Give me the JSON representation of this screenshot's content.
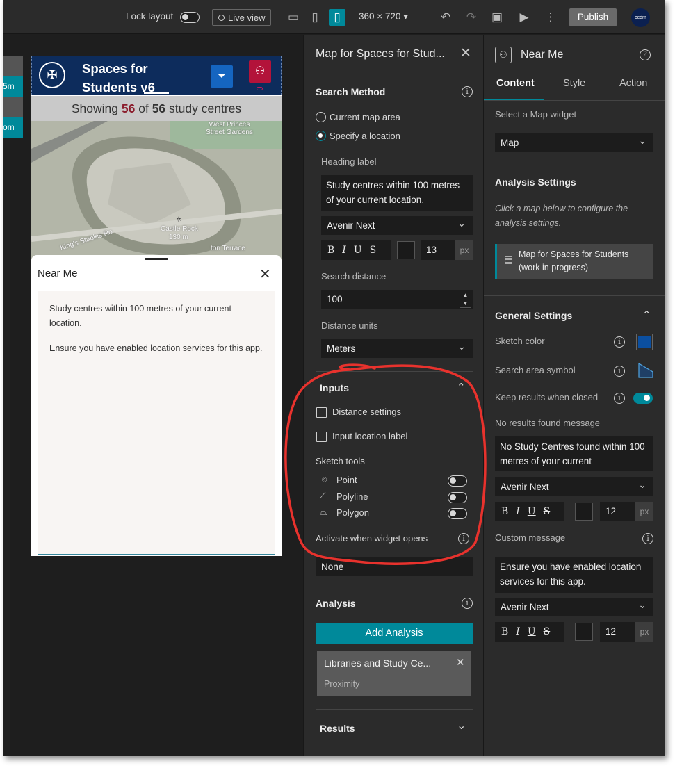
{
  "toolbar": {
    "lock_layout": "Lock layout",
    "lock_layout_on": false,
    "live_view": "Live view",
    "resolution": "360 × 720",
    "publish": "Publish",
    "avatar_text": "ccdm"
  },
  "canvas": {
    "side_labels": [
      "5m",
      "om"
    ],
    "app": {
      "title": "Spaces for Students v6",
      "showing_prefix": "Showing",
      "showing_count": "56",
      "showing_of": "of",
      "showing_total": "56",
      "showing_suffix": "study centres",
      "map_labels": [
        "West Princes Street Gardens",
        "Castle Rock",
        "130 m",
        "King's Stables Ro",
        "ton Terrace"
      ],
      "panel": {
        "title": "Near Me",
        "heading": "Study centres within 100 metres of your current location.",
        "message": "Ensure you have enabled location services for this app."
      }
    }
  },
  "middle": {
    "title": "Map for Spaces for Stud...",
    "search_method": {
      "title": "Search Method",
      "option_current": "Current map area",
      "option_specify": "Specify a location",
      "selected": "Specify a location"
    },
    "heading_label": {
      "label": "Heading label",
      "value": "Study centres within 100 metres of your current location.",
      "font": "Avenir Next",
      "size": "13",
      "unit": "px"
    },
    "search_distance": {
      "label": "Search distance",
      "value": "100"
    },
    "distance_units": {
      "label": "Distance units",
      "value": "Meters"
    },
    "inputs": {
      "title": "Inputs",
      "distance_settings": "Distance settings",
      "input_location_label": "Input location label",
      "sketch_tools": "Sketch tools",
      "point": "Point",
      "polyline": "Polyline",
      "polygon": "Polygon",
      "activate_label": "Activate when widget opens",
      "activate_value": "None"
    },
    "analysis": {
      "title": "Analysis",
      "add_button": "Add Analysis",
      "card_title": "Libraries and Study Ce...",
      "card_subtitle": "Proximity"
    },
    "results": {
      "title": "Results"
    }
  },
  "right": {
    "title": "Near Me",
    "tabs": [
      "Content",
      "Style",
      "Action"
    ],
    "active_tab": "Content",
    "select_map_label": "Select a Map widget",
    "map_select": "Map",
    "analysis_settings": {
      "title": "Analysis Settings",
      "hint": "Click a map below to configure the analysis settings.",
      "map_item": "Map for Spaces for Students (work in progress)"
    },
    "general": {
      "title": "General Settings",
      "sketch_color": "Sketch color",
      "sketch_color_value": "#0b4fa0",
      "search_area_symbol": "Search area symbol",
      "keep_results": "Keep results when closed",
      "keep_results_on": true,
      "no_results_label": "No results found message",
      "no_results_value": "No Study Centres found within 100 metres of your current",
      "no_results_font": "Avenir Next",
      "no_results_size": "12",
      "custom_label": "Custom message",
      "custom_value": "Ensure you have enabled location services for this app.",
      "custom_font": "Avenir Next",
      "custom_size": "12",
      "unit": "px"
    }
  },
  "colors": {
    "accent": "#00899a",
    "header_blue": "#0d2c5c",
    "annotation_red": "#e8322d"
  }
}
